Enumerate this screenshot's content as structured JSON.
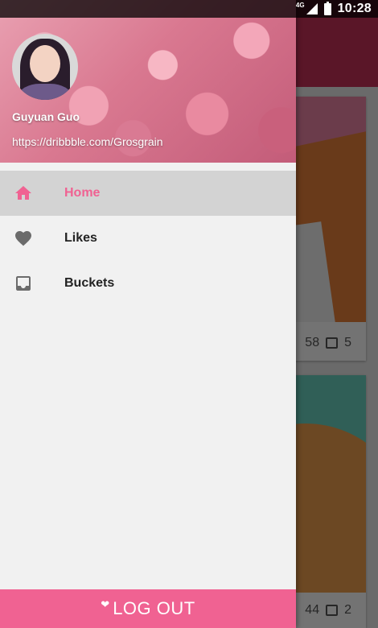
{
  "status_bar": {
    "network": "4G",
    "time": "10:28"
  },
  "drawer": {
    "header": {
      "user_name": "Guyuan Guo",
      "user_link": "https://dribbble.com/Grosgrain"
    },
    "nav_items": [
      {
        "label": "Home",
        "icon": "home-icon",
        "active": true
      },
      {
        "label": "Likes",
        "icon": "heart-icon",
        "active": false
      },
      {
        "label": "Buckets",
        "icon": "inbox-icon",
        "active": false
      }
    ],
    "logout_label": "LOG OUT"
  },
  "background": {
    "cards": [
      {
        "likes": "58",
        "comments": "5"
      },
      {
        "likes": "44",
        "comments": "2"
      }
    ]
  },
  "colors": {
    "accent": "#f06292",
    "active_row": "#d3d3d3",
    "drawer_bg": "#f1f1f1",
    "icon_gray": "#6b6b6b"
  }
}
